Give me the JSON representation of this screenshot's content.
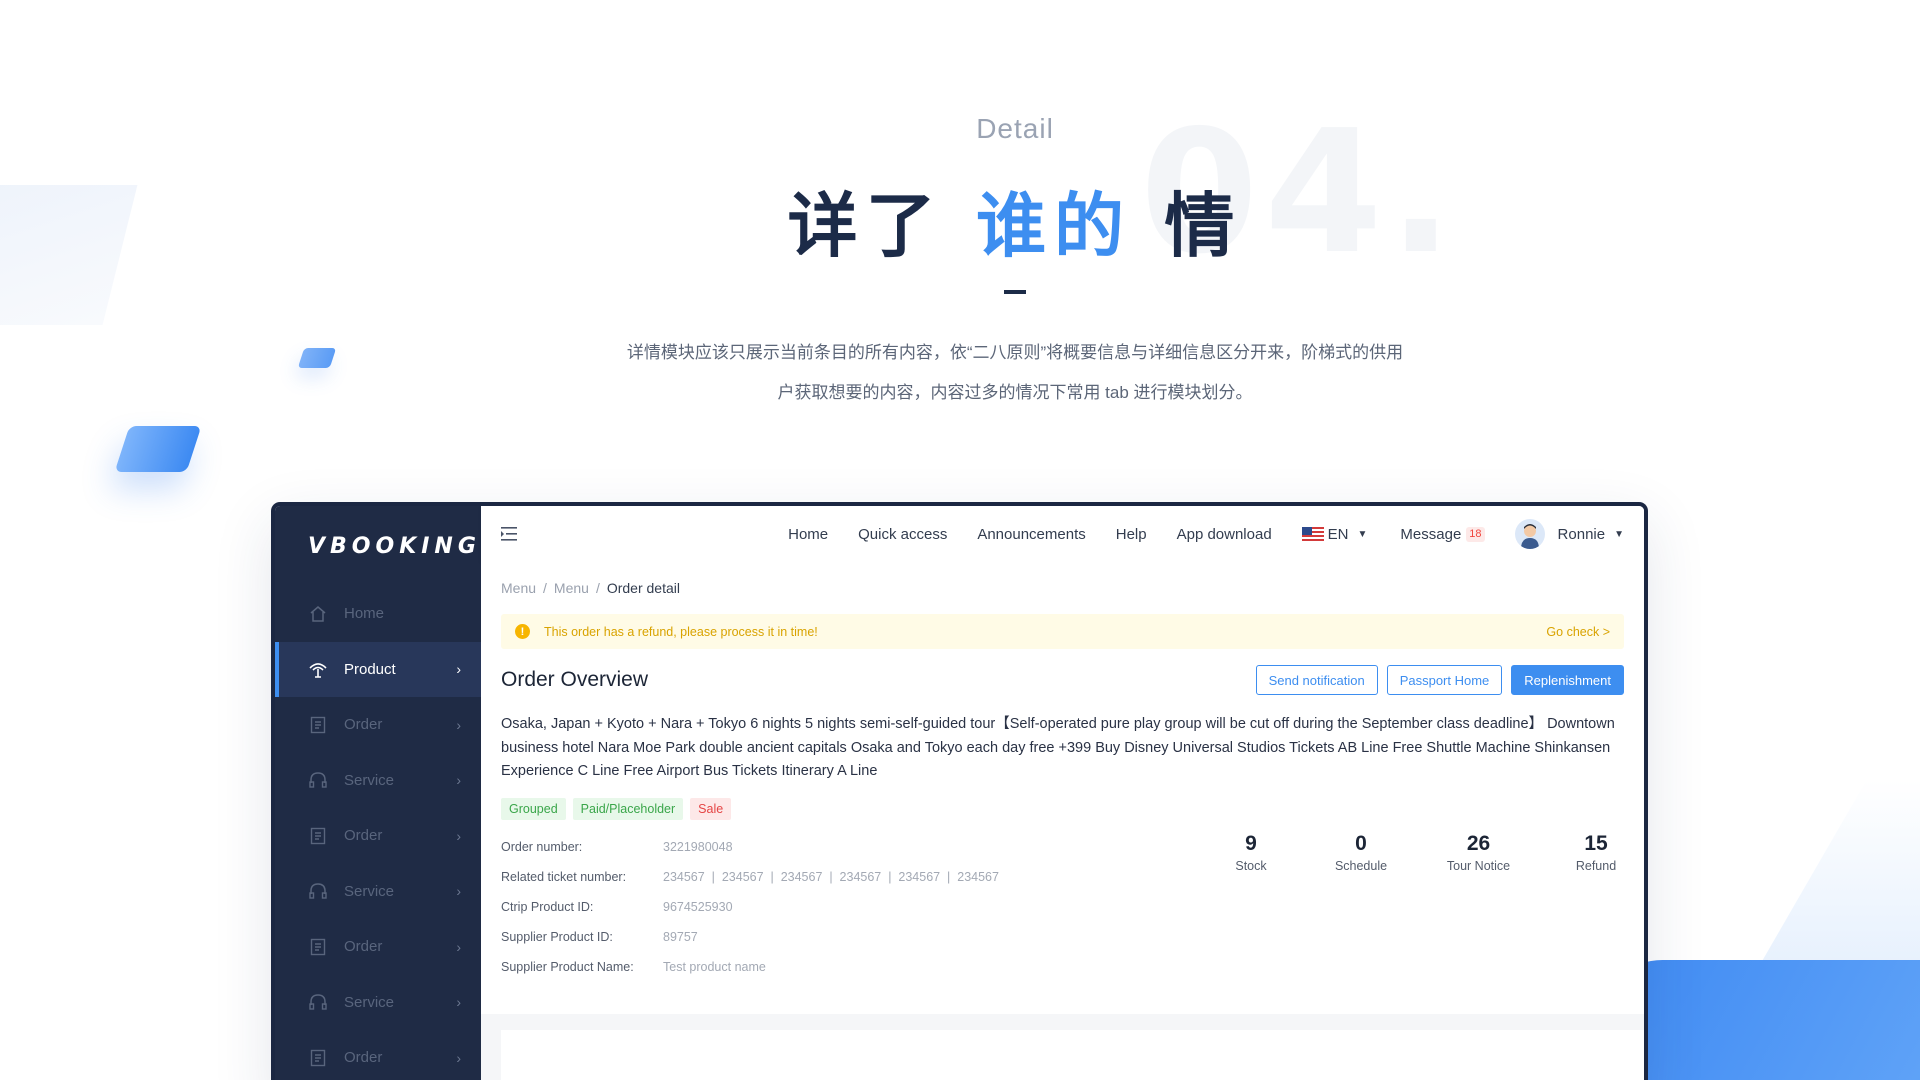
{
  "hero": {
    "detail_label": "Detail",
    "big_number": "04.",
    "headline_part1": "详了 ",
    "headline_accent": "谁的",
    "headline_part2": " 情",
    "intro_line1": "详情模块应该只展示当前条目的所有内容，依“二八原则”将概要信息与详细信息区分开来，阶梯式的供用",
    "intro_line2": "户获取想要的内容，内容过多的情况下常用 tab 进行模块划分。"
  },
  "colors": {
    "accent": "#3d8ef0",
    "sidebar_bg": "#1f2b45",
    "warning": "#f7b500",
    "tag_green": "#3aa64a",
    "tag_red": "#e54545"
  },
  "sidebar": {
    "logo": "VBOOKING",
    "items": [
      {
        "label": "Home",
        "icon": "home-icon",
        "has_children": false,
        "active": false
      },
      {
        "label": "Product",
        "icon": "product-icon",
        "has_children": true,
        "active": true
      },
      {
        "label": "Order",
        "icon": "order-icon",
        "has_children": true,
        "active": false
      },
      {
        "label": "Service",
        "icon": "headset-icon",
        "has_children": true,
        "active": false
      },
      {
        "label": "Order",
        "icon": "order-icon",
        "has_children": true,
        "active": false
      },
      {
        "label": "Service",
        "icon": "headset-icon",
        "has_children": true,
        "active": false
      },
      {
        "label": "Order",
        "icon": "order-icon",
        "has_children": true,
        "active": false
      },
      {
        "label": "Service",
        "icon": "headset-icon",
        "has_children": true,
        "active": false
      },
      {
        "label": "Order",
        "icon": "order-icon",
        "has_children": true,
        "active": false
      }
    ]
  },
  "topbar": {
    "links": [
      "Home",
      "Quick access",
      "Announcements",
      "Help",
      "App download"
    ],
    "language": "EN",
    "message_label": "Message",
    "message_count": "18",
    "user_name": "Ronnie"
  },
  "breadcrumb": [
    "Menu",
    "Menu",
    "Order detail"
  ],
  "alert": {
    "text": "This order has a refund, please process it in time!",
    "link": "Go check >"
  },
  "overview": {
    "title": "Order Overview",
    "actions": [
      "Send notification",
      "Passport Home",
      "Replenishment"
    ],
    "product_name": "Osaka, Japan + Kyoto + Nara + Tokyo 6 nights 5 nights semi-self-guided tour【Self-operated pure play group will be cut off during the September class deadline】 Downtown business hotel Nara Moe Park double ancient capitals Osaka and Tokyo each day free +399 Buy Disney Universal Studios Tickets AB Line Free Shuttle Machine Shinkansen Experience C Line Free Airport Bus Tickets Itinerary A Line",
    "tags": [
      {
        "label": "Grouped",
        "tone": "green"
      },
      {
        "label": "Paid/Placeholder",
        "tone": "green"
      },
      {
        "label": "Sale",
        "tone": "red"
      }
    ],
    "info": [
      {
        "label": "Order number:",
        "value": "3221980048"
      },
      {
        "label": "Related ticket number:",
        "value": "234567  |  234567  |  234567  |  234567  |  234567  |  234567"
      },
      {
        "label": "Ctrip Product ID:",
        "value": "9674525930"
      },
      {
        "label": "Supplier Product ID:",
        "value": "89757"
      },
      {
        "label": "Supplier Product Name:",
        "value": "Test product name"
      }
    ],
    "stats": [
      {
        "value": "9",
        "label": "Stock"
      },
      {
        "value": "0",
        "label": "Schedule"
      },
      {
        "value": "26",
        "label": "Tour Notice"
      },
      {
        "value": "15",
        "label": "Refund"
      }
    ]
  }
}
